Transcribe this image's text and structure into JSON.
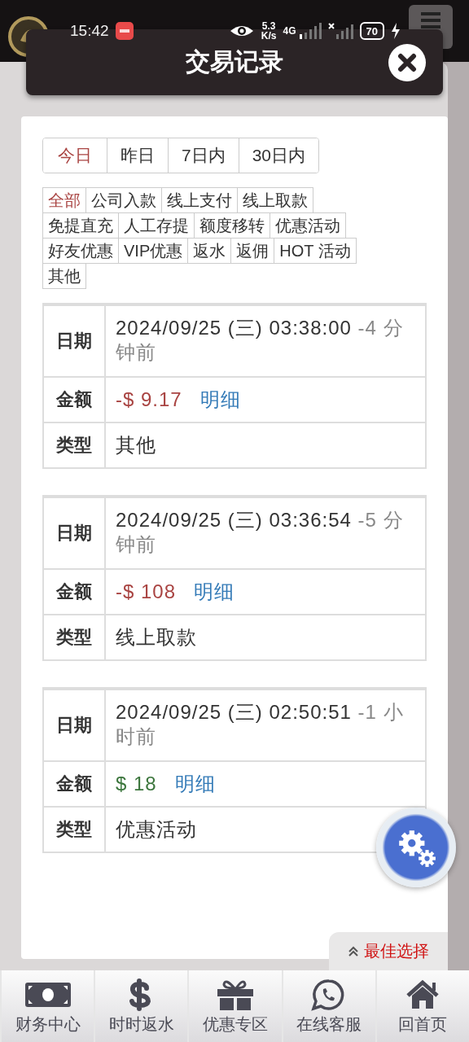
{
  "status_bar": {
    "time": "15:42",
    "speed": "5.3",
    "speed_unit": "K/s",
    "network": "4G",
    "battery": "70"
  },
  "dialog": {
    "title": "交易记录"
  },
  "period_tabs": [
    {
      "label": "今日",
      "selected": true
    },
    {
      "label": "昨日",
      "selected": false
    },
    {
      "label": "7日内",
      "selected": false
    },
    {
      "label": "30日内",
      "selected": false
    }
  ],
  "type_filters": [
    {
      "label": "全部",
      "selected": true
    },
    {
      "label": "公司入款",
      "selected": false
    },
    {
      "label": "线上支付",
      "selected": false
    },
    {
      "label": "线上取款",
      "selected": false
    },
    {
      "label": "免提直充",
      "selected": false
    },
    {
      "label": "人工存提",
      "selected": false
    },
    {
      "label": "额度移转",
      "selected": false
    },
    {
      "label": "优惠活动",
      "selected": false
    },
    {
      "label": "好友优惠",
      "selected": false
    },
    {
      "label": "VIP优惠",
      "selected": false
    },
    {
      "label": "返水",
      "selected": false
    },
    {
      "label": "返佣",
      "selected": false
    },
    {
      "label": "HOT 活动",
      "selected": false
    },
    {
      "label": "其他",
      "selected": false
    }
  ],
  "records": [
    {
      "rows": [
        {
          "kind": "date",
          "label": "日期",
          "value": "2024/09/25 (三) 03:38:00",
          "note": "-4 分钟前"
        },
        {
          "kind": "amount",
          "label": "金额",
          "value": "-$ 9.17",
          "color": "#a94442",
          "link": "明细"
        },
        {
          "kind": "text",
          "label": "类型",
          "value": "其他"
        }
      ]
    },
    {
      "rows": [
        {
          "kind": "date",
          "label": "日期",
          "value": "2024/09/25 (三) 03:36:54",
          "note": "-5 分钟前"
        },
        {
          "kind": "amount",
          "label": "金额",
          "value": "-$ 108",
          "color": "#a94442",
          "link": "明细"
        },
        {
          "kind": "text",
          "label": "类型",
          "value": "线上取款"
        }
      ]
    },
    {
      "rows": [
        {
          "kind": "date",
          "label": "日期",
          "value": "2024/09/25 (三) 02:50:51",
          "note": "-1 小时前"
        },
        {
          "kind": "amount",
          "label": "金额",
          "value": "$ 18",
          "color": "#3c763d",
          "link": "明细"
        },
        {
          "kind": "text",
          "label": "类型",
          "value": "优惠活动"
        }
      ]
    }
  ],
  "best_choice": {
    "label": "最佳选择"
  },
  "bottom_nav": [
    {
      "label": "财务中心",
      "kind": "money"
    },
    {
      "label": "时时返水",
      "kind": "dollar"
    },
    {
      "label": "优惠专区",
      "kind": "gift"
    },
    {
      "label": "在线客服",
      "kind": "chat"
    },
    {
      "label": "回首页",
      "kind": "home"
    }
  ]
}
